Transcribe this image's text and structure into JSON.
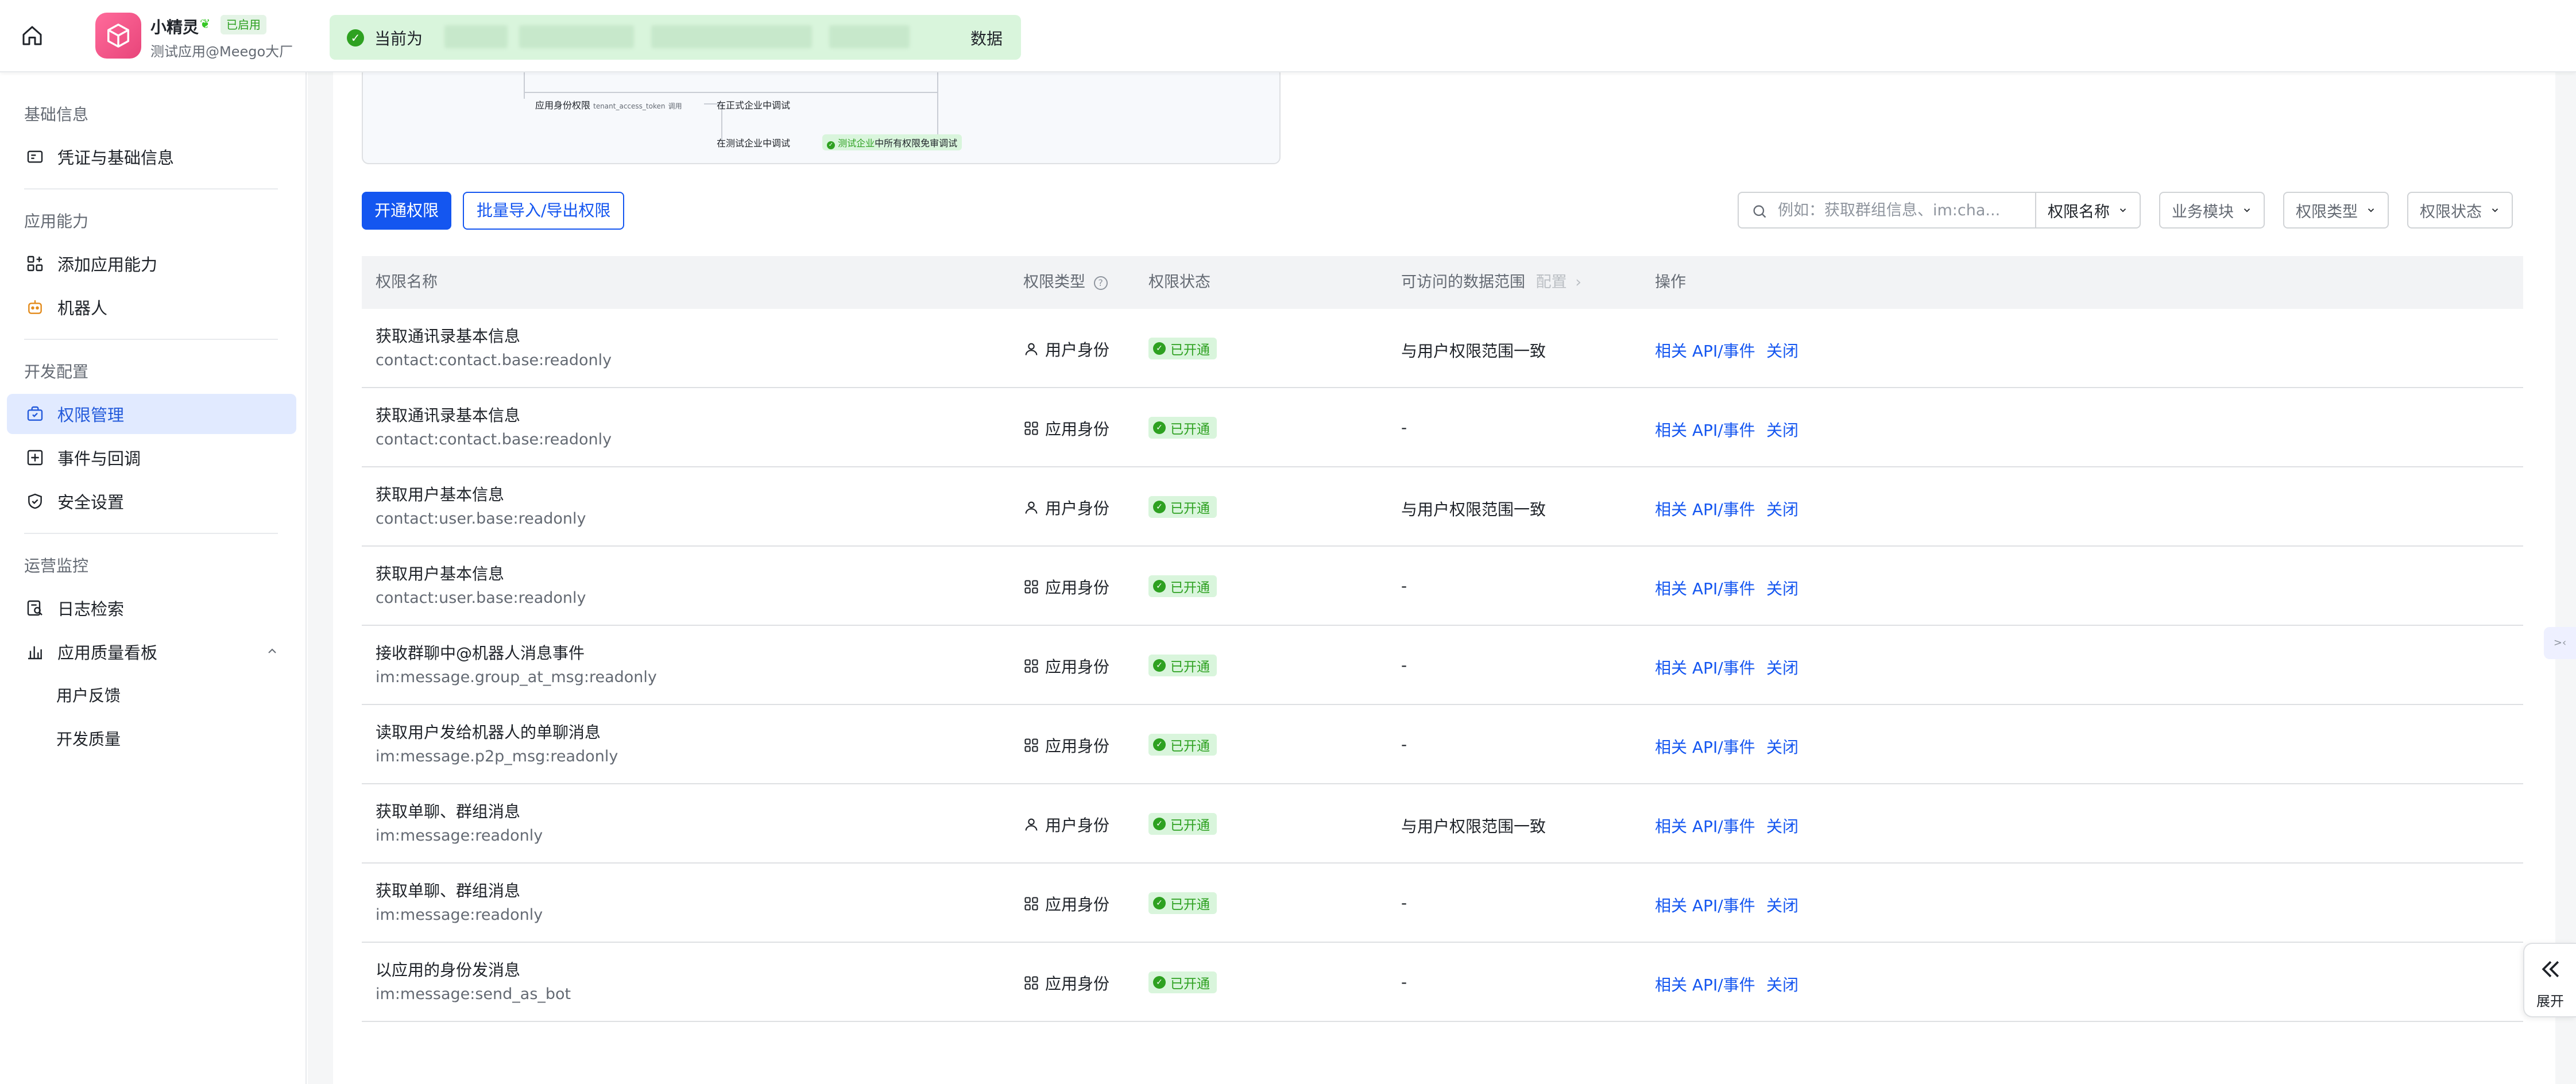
{
  "header": {
    "app_name": "小精灵",
    "app_status": "已启用",
    "app_subtitle": "测试应用@Meego大厂",
    "notice_prefix": "当前为",
    "notice_suffix": "数据"
  },
  "sidebar": {
    "sections": [
      {
        "title": "基础信息",
        "items": [
          {
            "label": "凭证与基础信息",
            "icon": "credential-icon"
          }
        ]
      },
      {
        "title": "应用能力",
        "items": [
          {
            "label": "添加应用能力",
            "icon": "grid-plus-icon"
          },
          {
            "label": "机器人",
            "icon": "robot-icon"
          }
        ]
      },
      {
        "title": "开发配置",
        "items": [
          {
            "label": "权限管理",
            "icon": "permission-icon",
            "active": true
          },
          {
            "label": "事件与回调",
            "icon": "event-icon"
          },
          {
            "label": "安全设置",
            "icon": "shield-icon"
          }
        ]
      },
      {
        "title": "运营监控",
        "items": [
          {
            "label": "日志检索",
            "icon": "log-search-icon"
          },
          {
            "label": "应用质量看板",
            "icon": "bar-chart-icon",
            "expanded": true,
            "children": [
              "用户反馈",
              "开发质量"
            ]
          }
        ]
      }
    ]
  },
  "diagram": {
    "node_app_perm": "应用身份权限",
    "node_app_perm_token": "tenant_access_token",
    "node_app_perm_suffix": "调用",
    "node_formal": "在正式企业中调试",
    "node_test": "在测试企业中调试",
    "chip_test_prefix": "测试企业",
    "chip_test_rest": "中所有权限免审调试"
  },
  "toolbar": {
    "enable_button": "开通权限",
    "batch_button": "批量导入/导出权限",
    "search_placeholder": "例如：获取群组信息、im:cha...",
    "search_field_select": "权限名称",
    "filter_module": "业务模块",
    "filter_type": "权限类型",
    "filter_status": "权限状态"
  },
  "table": {
    "columns": {
      "name": "权限名称",
      "type": "权限类型",
      "status": "权限状态",
      "range": "可访问的数据范围",
      "range_config": "配置",
      "actions": "操作"
    },
    "rows": [
      {
        "name": "获取通讯录基本信息",
        "code": "contact:contact.base:readonly",
        "type": "用户身份",
        "type_icon": "user-icon",
        "status": "已开通",
        "range": "与用户权限范围一致",
        "action_api": "相关 API/事件",
        "action_close": "关闭"
      },
      {
        "name": "获取通讯录基本信息",
        "code": "contact:contact.base:readonly",
        "type": "应用身份",
        "type_icon": "app-icon",
        "status": "已开通",
        "range": "-",
        "action_api": "相关 API/事件",
        "action_close": "关闭"
      },
      {
        "name": "获取用户基本信息",
        "code": "contact:user.base:readonly",
        "type": "用户身份",
        "type_icon": "user-icon",
        "status": "已开通",
        "range": "与用户权限范围一致",
        "action_api": "相关 API/事件",
        "action_close": "关闭"
      },
      {
        "name": "获取用户基本信息",
        "code": "contact:user.base:readonly",
        "type": "应用身份",
        "type_icon": "app-icon",
        "status": "已开通",
        "range": "-",
        "action_api": "相关 API/事件",
        "action_close": "关闭"
      },
      {
        "name": "接收群聊中@机器人消息事件",
        "code": "im:message.group_at_msg:readonly",
        "type": "应用身份",
        "type_icon": "app-icon",
        "status": "已开通",
        "range": "-",
        "action_api": "相关 API/事件",
        "action_close": "关闭"
      },
      {
        "name": "读取用户发给机器人的单聊消息",
        "code": "im:message.p2p_msg:readonly",
        "type": "应用身份",
        "type_icon": "app-icon",
        "status": "已开通",
        "range": "-",
        "action_api": "相关 API/事件",
        "action_close": "关闭"
      },
      {
        "name": "获取单聊、群组消息",
        "code": "im:message:readonly",
        "type": "用户身份",
        "type_icon": "user-icon",
        "status": "已开通",
        "range": "与用户权限范围一致",
        "action_api": "相关 API/事件",
        "action_close": "关闭"
      },
      {
        "name": "获取单聊、群组消息",
        "code": "im:message:readonly",
        "type": "应用身份",
        "type_icon": "app-icon",
        "status": "已开通",
        "range": "-",
        "action_api": "相关 API/事件",
        "action_close": "关闭"
      },
      {
        "name": "以应用的身份发消息",
        "code": "im:message:send_as_bot",
        "type": "应用身份",
        "type_icon": "app-icon",
        "status": "已开通",
        "range": "-",
        "action_api": "相关 API/事件",
        "action_close": "关闭"
      }
    ]
  },
  "expand_panel": {
    "label": "展开"
  },
  "colors": {
    "primary": "#1456f0",
    "success": "#2ea121",
    "active_nav_bg": "#e1eaff"
  }
}
